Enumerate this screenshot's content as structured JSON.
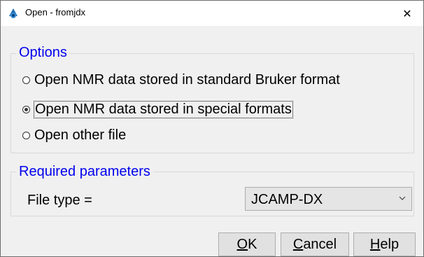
{
  "window": {
    "title": "Open - fromjdx",
    "close_glyph": "✕"
  },
  "options": {
    "label": "Options",
    "items": [
      {
        "label": "Open NMR data stored in standard Bruker format",
        "checked": false
      },
      {
        "label": "Open NMR data stored in special formats",
        "checked": true
      },
      {
        "label": "Open other file",
        "checked": false
      }
    ]
  },
  "params": {
    "label": "Required parameters",
    "file_type_label": "File type =",
    "file_type_value": "JCAMP-DX"
  },
  "buttons": {
    "ok": {
      "mnemonic": "O",
      "rest": "K"
    },
    "cancel": {
      "mnemonic": "C",
      "rest": "ancel"
    },
    "help": {
      "mnemonic": "H",
      "rest": "elp"
    }
  },
  "colors": {
    "group_label": "#0000ee",
    "dialog_bg": "#f0f0f0"
  },
  "icons": [
    "app-icon",
    "close-icon",
    "chevron-down-icon"
  ]
}
